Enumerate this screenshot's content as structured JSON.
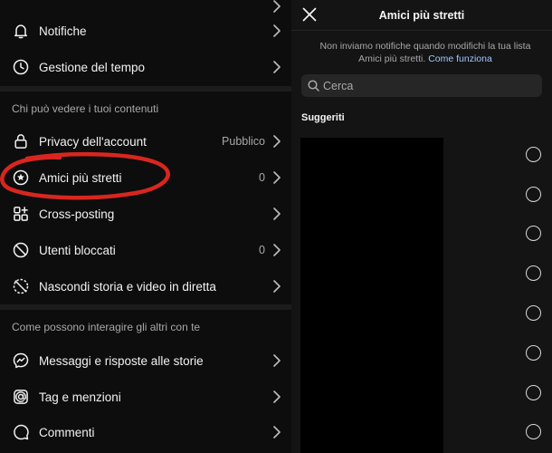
{
  "settings_menu": {
    "items": [
      {
        "key": "notifications",
        "label": "Notifiche",
        "icon": "bell-icon",
        "value": ""
      },
      {
        "key": "time_management",
        "label": "Gestione del tempo",
        "icon": "clock-icon",
        "value": ""
      },
      {
        "key": "account_privacy",
        "label": "Privacy dell'account",
        "icon": "lock-icon",
        "value": "Pubblico"
      },
      {
        "key": "close_friends",
        "label": "Amici più stretti",
        "icon": "star-circle-icon",
        "value": "0"
      },
      {
        "key": "crossposting",
        "label": "Cross-posting",
        "icon": "crossposting-icon",
        "value": ""
      },
      {
        "key": "blocked_users",
        "label": "Utenti bloccati",
        "icon": "blocked-icon",
        "value": "0"
      },
      {
        "key": "hide_story",
        "label": "Nascondi storia e video in diretta",
        "icon": "hide-story-icon",
        "value": ""
      },
      {
        "key": "messages",
        "label": "Messaggi e risposte alle storie",
        "icon": "messenger-icon",
        "value": ""
      },
      {
        "key": "tags",
        "label": "Tag e menzioni",
        "icon": "at-icon",
        "value": ""
      },
      {
        "key": "comments",
        "label": "Commenti",
        "icon": "comment-icon",
        "value": ""
      }
    ],
    "sections": {
      "who_can_see": "Chi può vedere i tuoi contenuti",
      "how_others_interact": "Come possono interagire gli altri con te"
    }
  },
  "close_friends_panel": {
    "title": "Amici più stretti",
    "notice_text": "Non inviamo notifiche quando modifichi la tua lista Amici più stretti.",
    "notice_link": "Come funziona",
    "search_placeholder": "Cerca",
    "suggestions_heading": "Suggeriti"
  },
  "colors": {
    "background": "#0d0d0d",
    "panel": "#141414",
    "text": "#f5f5f5",
    "secondary_text": "#a8a8a8",
    "link": "#9ec9ff",
    "annotation_red": "#d8261f"
  }
}
